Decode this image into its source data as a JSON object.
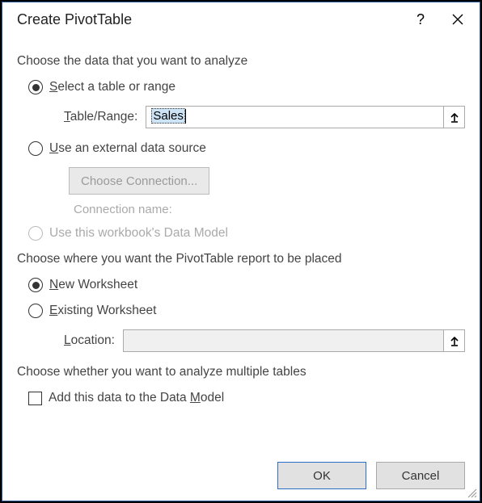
{
  "title": "Create PivotTable",
  "sections": {
    "analyze": {
      "heading": "Choose the data that you want to analyze",
      "opt_select_range": {
        "pre": "",
        "u": "S",
        "post": "elect a table or range",
        "checked": true
      },
      "table_range": {
        "label_pre": "",
        "label_u": "T",
        "label_post": "able/Range:",
        "value": "Sales"
      },
      "opt_external": {
        "pre": "",
        "u": "U",
        "post": "se an external data source",
        "checked": false
      },
      "choose_connection_btn": "Choose Connection...",
      "connection_name_label": "Connection name:",
      "opt_datamodel": {
        "text": "Use this workbook's Data Model",
        "checked": false,
        "disabled": true
      }
    },
    "placement": {
      "heading": "Choose where you want the PivotTable report to be placed",
      "opt_new": {
        "pre": "",
        "u": "N",
        "post": "ew Worksheet",
        "checked": true
      },
      "opt_existing": {
        "pre": "",
        "u": "E",
        "post": "xisting Worksheet",
        "checked": false
      },
      "location": {
        "label_pre": "",
        "label_u": "L",
        "label_post": "ocation:",
        "value": ""
      }
    },
    "multiple": {
      "heading": "Choose whether you want to analyze multiple tables",
      "opt_add_datamodel": {
        "pre": "Add this data to the Data ",
        "u": "M",
        "post": "odel",
        "checked": false
      }
    }
  },
  "buttons": {
    "ok": "OK",
    "cancel": "Cancel"
  }
}
